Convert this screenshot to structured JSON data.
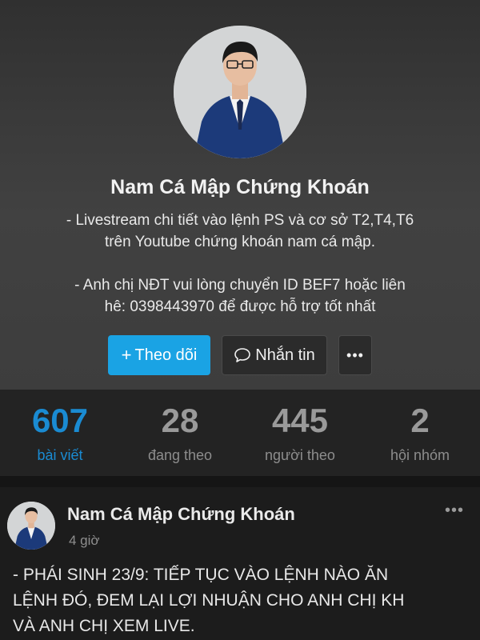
{
  "profile": {
    "name": "Nam Cá Mập Chứng Khoán",
    "bio_line1": "- Livestream chi tiết vào lệnh PS và cơ sở T2,T4,T6",
    "bio_line2": "trên Youtube chứng khoán nam cá mập.",
    "bio_line3": "- Anh chị NĐT vui lòng chuyển ID BEF7 hoặc liên",
    "bio_line4": "hê: 0398443970 để được hỗ trợ tốt nhất"
  },
  "actions": {
    "follow_icon": "+",
    "follow_label": "Theo dõi",
    "message_label": "Nhắn tin",
    "more_label": "•••"
  },
  "stats": [
    {
      "value": "607",
      "label": "bài viết"
    },
    {
      "value": "28",
      "label": "đang theo"
    },
    {
      "value": "445",
      "label": "người theo"
    },
    {
      "value": "2",
      "label": "hội nhóm"
    }
  ],
  "post": {
    "author": "Nam Cá Mập Chứng Khoán",
    "time": "4 giờ",
    "menu_label": "•••",
    "body_line1": "- PHÁI SINH 23/9: TIẾP TỤC VÀO LỆNH NÀO ĂN",
    "body_line2": "LỆNH ĐÓ, ĐEM LẠI LỢI NHUẬN CHO ANH CHỊ KH",
    "body_line3": "VÀ ANH CHỊ XEM LIVE."
  },
  "colors": {
    "accent": "#1aa3e4",
    "active_stat": "#1a8bd2"
  }
}
